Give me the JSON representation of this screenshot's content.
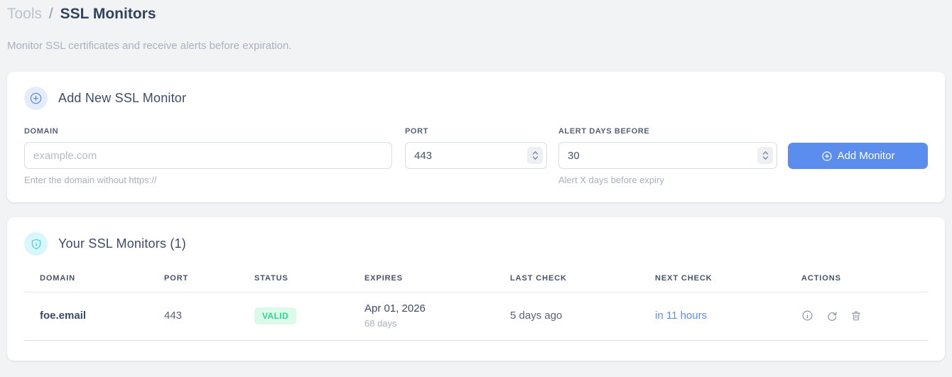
{
  "breadcrumb": {
    "section": "Tools",
    "separator": "/",
    "current": "SSL Monitors"
  },
  "subtitle": "Monitor SSL certificates and receive alerts before expiration.",
  "add_card": {
    "title": "Add New SSL Monitor",
    "fields": {
      "domain": {
        "label": "DOMAIN",
        "placeholder": "example.com",
        "helper": "Enter the domain without https://"
      },
      "port": {
        "label": "PORT",
        "value": "443"
      },
      "alert_days": {
        "label": "ALERT DAYS BEFORE",
        "value": "30",
        "helper": "Alert X days before expiry"
      }
    },
    "submit_label": "Add Monitor"
  },
  "monitors_card": {
    "title": "Your SSL Monitors (1)",
    "table": {
      "headers": [
        "DOMAIN",
        "PORT",
        "STATUS",
        "EXPIRES",
        "LAST CHECK",
        "NEXT CHECK",
        "ACTIONS"
      ],
      "rows": [
        {
          "domain": "foe.email",
          "port": "443",
          "status": "VALID",
          "expires_date": "Apr 01, 2026",
          "expires_days": "68 days",
          "last_check": "5 days ago",
          "next_check": "in 11 hours"
        }
      ]
    }
  },
  "colors": {
    "accent_blue": "#5b8def",
    "accent_cyan": "#3bcfde",
    "valid_text": "#2ed492",
    "valid_bg": "#ddf9e9",
    "page_bg": "#f2f3f5"
  }
}
